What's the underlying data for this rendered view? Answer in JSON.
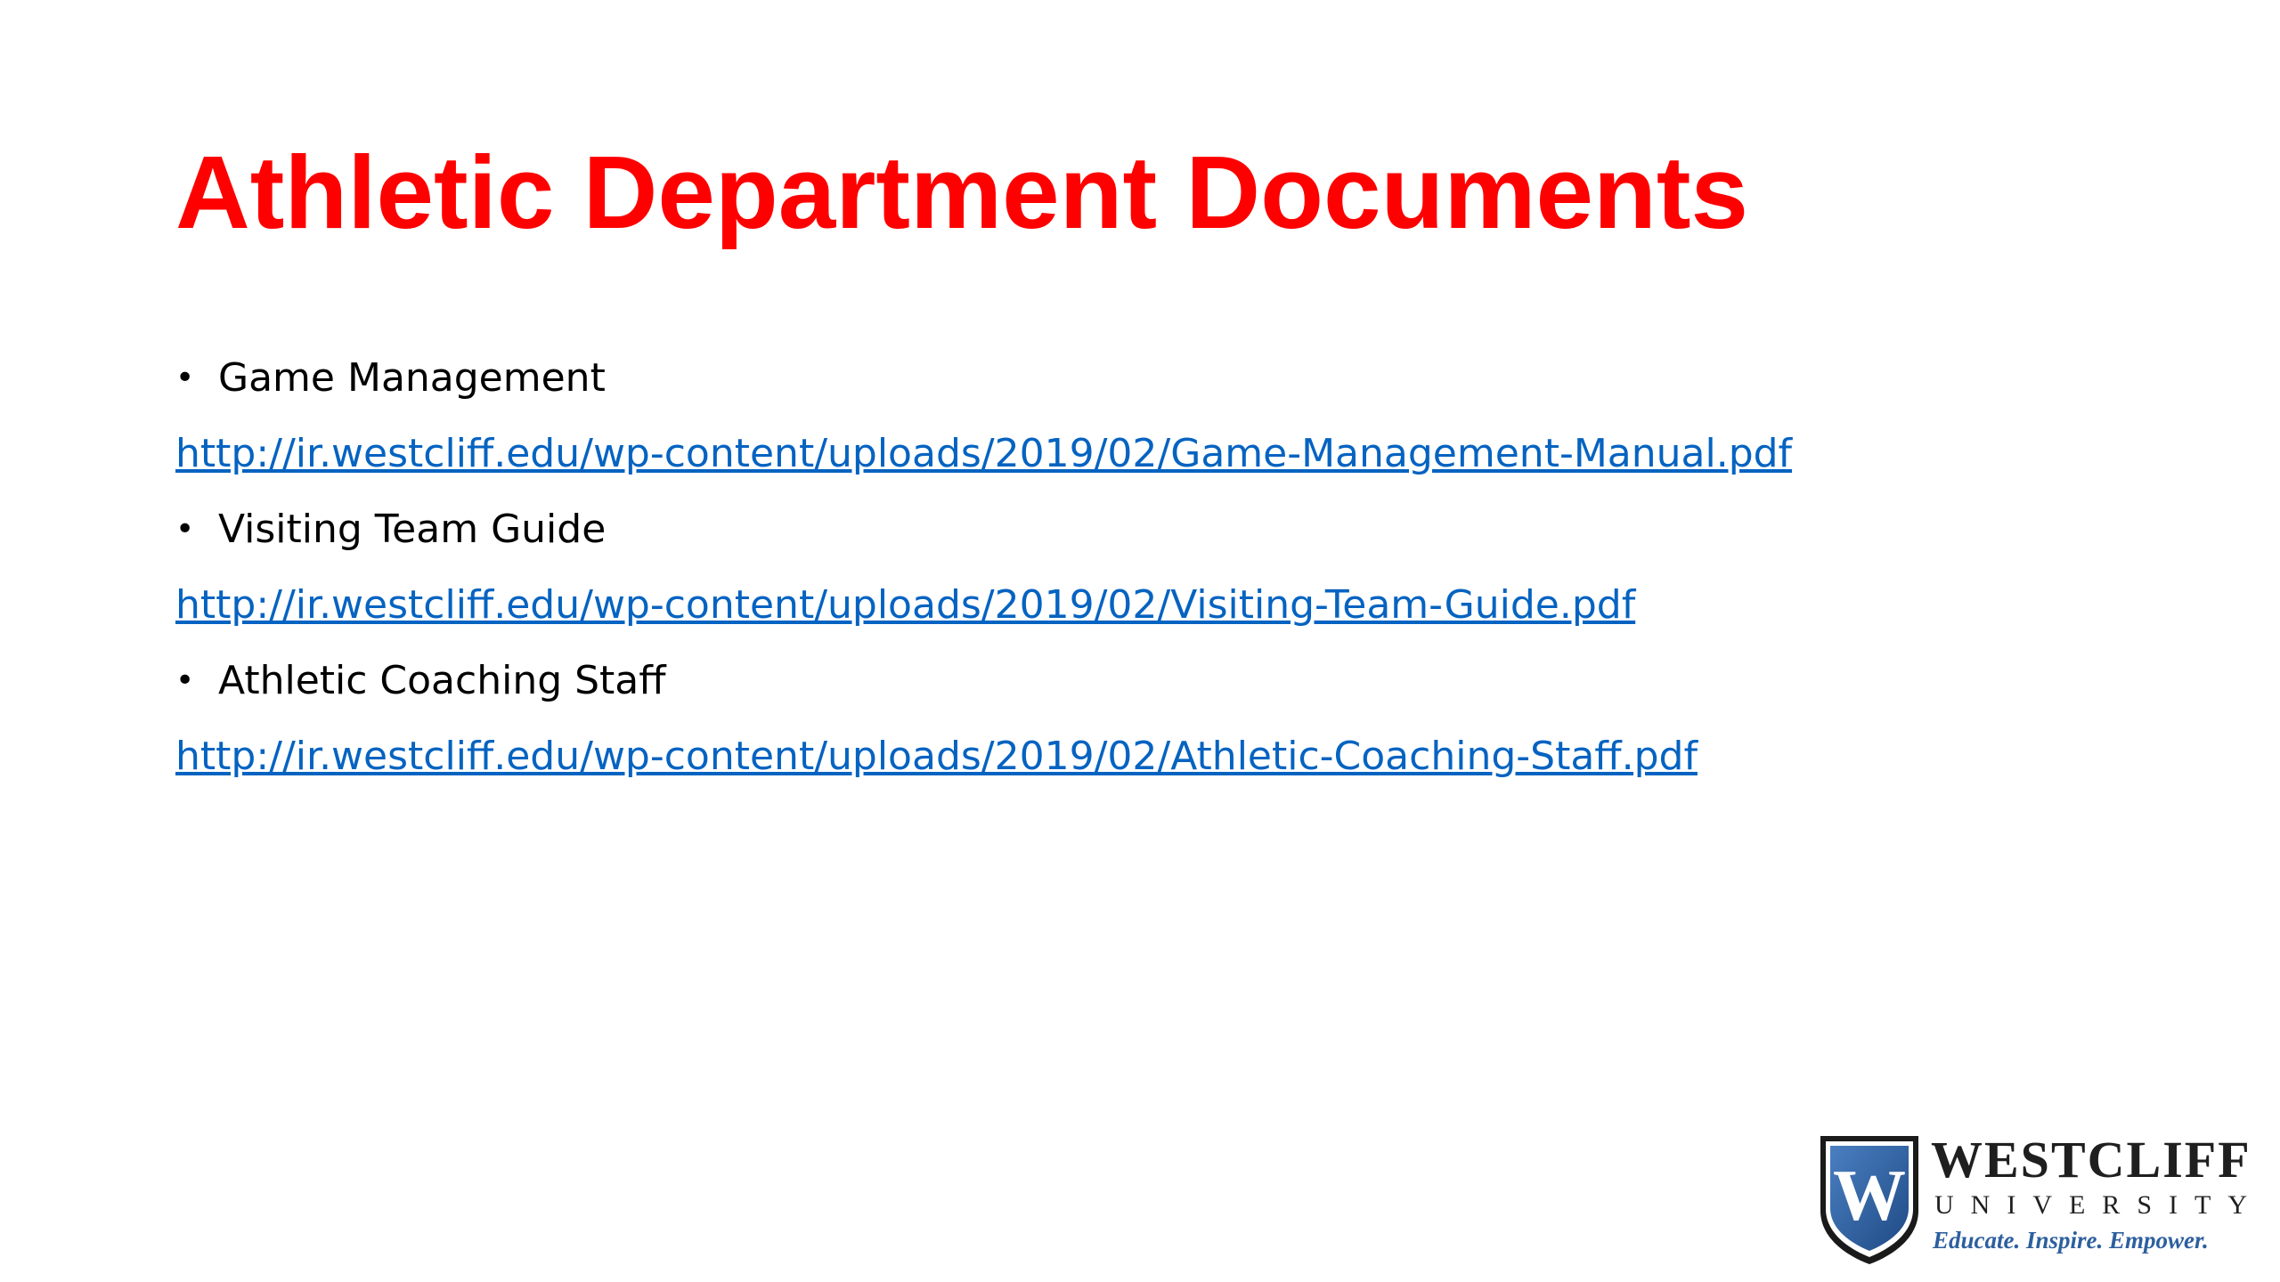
{
  "slide": {
    "title": "Athletic Department Documents",
    "items": [
      {
        "bullet": "•",
        "label": "Game Management",
        "url": "http://ir.westcliff.edu/wp-content/uploads/2019/02/Game-Management-Manual.pdf"
      },
      {
        "bullet": "•",
        "label": "Visiting Team Guide",
        "url": "http://ir.westcliff.edu/wp-content/uploads/2019/02/Visiting-Team-Guide.pdf"
      },
      {
        "bullet": "•",
        "label": "Athletic Coaching Staff",
        "url": "http://ir.westcliff.edu/wp-content/uploads/2019/02/Athletic-Coaching-Staff.pdf"
      }
    ]
  },
  "logo": {
    "icon": "westcliff-shield-icon",
    "monogram": "W",
    "name": "WESTCLIFF",
    "subname": "UNIVERSITY",
    "tagline": "Educate. Inspire. Empower."
  },
  "colors": {
    "title": "#ff0000",
    "link": "#0563c1",
    "body_text": "#000000",
    "logo_blue": "#2d5f9e"
  }
}
